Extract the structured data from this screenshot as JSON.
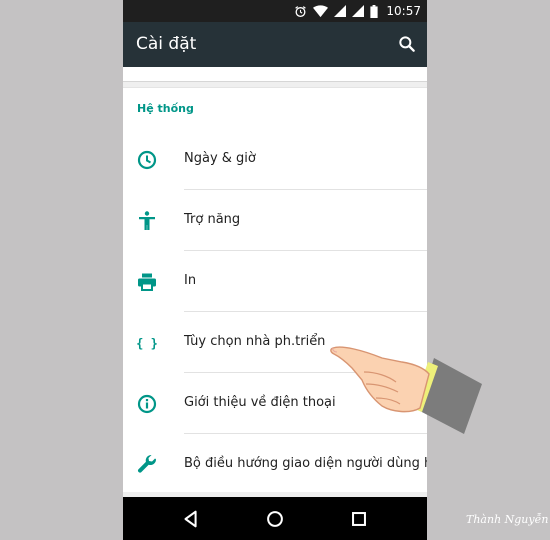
{
  "status_bar": {
    "time": "10:57"
  },
  "app_bar": {
    "title": "Cài đặt",
    "search_icon": "search-icon"
  },
  "section": {
    "header": "Hệ thống"
  },
  "items": [
    {
      "label": "Ngày & giờ",
      "icon": "clock-icon"
    },
    {
      "label": "Trợ năng",
      "icon": "accessibility-icon"
    },
    {
      "label": "In",
      "icon": "printer-icon"
    },
    {
      "label": "Tùy chọn nhà ph.triển",
      "icon": "developer-braces-icon",
      "icon_text": "{ }"
    },
    {
      "label": "Giới thiệu về điện thoại",
      "icon": "info-icon"
    },
    {
      "label": "Bộ điều hướng giao diện người dùng hệ..",
      "icon": "wrench-icon"
    }
  ],
  "watermark": {
    "text": "Thành Nguyễn"
  },
  "colors": {
    "accent": "#009688",
    "app_bar": "#263238",
    "status_bar": "#1f1f1f",
    "nav_bar": "#000000"
  }
}
